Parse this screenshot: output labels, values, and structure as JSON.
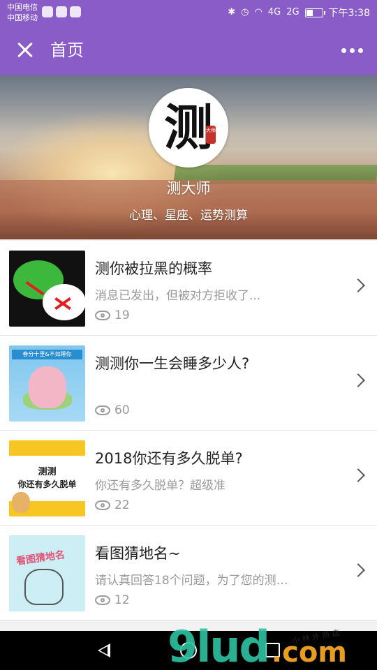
{
  "status_bar": {
    "carrier1": "中国电信",
    "carrier2": "中国移动",
    "network1": "4G",
    "network2": "2G",
    "time": "下午3:38",
    "battery_level": 0.45
  },
  "navbar": {
    "title": "首页",
    "close_icon": "close-icon",
    "more_icon": "more-dots-icon"
  },
  "banner": {
    "logo_char": "测",
    "logo_seal": "大师",
    "name": "测大师",
    "subtitle": "心理、星座、运势测算"
  },
  "items": [
    {
      "title": "测你被拉黑的概率",
      "desc": "消息已发出，但被对方拒收了...",
      "views": "19"
    },
    {
      "title": "测测你一生会睡多少人?",
      "desc": "",
      "views": "60"
    },
    {
      "title": "2018你还有多久脱单?",
      "desc": "你还有多久脱单？超级准",
      "views": "22"
    },
    {
      "title": "看图猜地名~",
      "desc": "请认真回答18个问题，为了您的测…",
      "views": "12"
    }
  ],
  "thumbs": {
    "t2_band": "春分十里&不如睡你",
    "t3_line1": "测测",
    "t3_line2": "你还有多久脱单",
    "t4_text": "看图猜地名"
  },
  "watermark": {
    "main": "9lud",
    "com": ".com",
    "small": "小 林 外 商 店"
  },
  "colors": {
    "brand_purple": "#8a5cc8",
    "text_gray": "#9a9a9a"
  }
}
